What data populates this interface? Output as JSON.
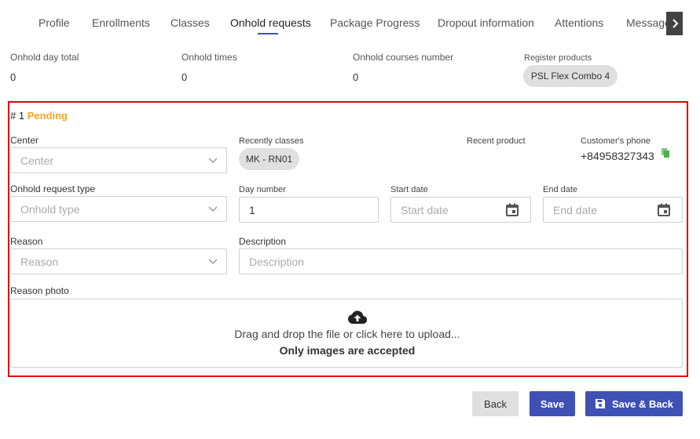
{
  "tabs": [
    {
      "label": "Profile"
    },
    {
      "label": "Enrollments"
    },
    {
      "label": "Classes"
    },
    {
      "label": "Onhold requests"
    },
    {
      "label": "Package Progress"
    },
    {
      "label": "Dropout information"
    },
    {
      "label": "Attentions"
    },
    {
      "label": "Messages"
    }
  ],
  "active_tab": "Onhold requests",
  "summary": {
    "day_total_label": "Onhold day total",
    "day_total_value": "0",
    "times_label": "Onhold times",
    "times_value": "0",
    "courses_label": "Onhold courses number",
    "courses_value": "0",
    "register_products_label": "Register products",
    "register_products_chip": "PSL Flex Combo 4"
  },
  "request": {
    "number": "# 1",
    "status": "Pending",
    "status_color": "#f5a623",
    "center_label": "Center",
    "center_placeholder": "Center",
    "recent_classes_label": "Recently classes",
    "recent_class_chip": "MK - RN01",
    "recent_product_label": "Recent product",
    "phone_label": "Customer's phone",
    "phone_value": "+84958327343",
    "type_label": "Onhold request type",
    "type_placeholder": "Onhold type",
    "day_number_label": "Day number",
    "day_number_value": "1",
    "start_date_label": "Start date",
    "start_date_placeholder": "Start date",
    "end_date_label": "End date",
    "end_date_placeholder": "End date",
    "reason_label": "Reason",
    "reason_placeholder": "Reason",
    "description_label": "Description",
    "description_placeholder": "Description",
    "photo_label": "Reason photo",
    "upload_text": "Drag and drop the file or click here to upload...",
    "upload_subtext": "Only images are accepted"
  },
  "actions": {
    "back": "Back",
    "save": "Save",
    "save_back": "Save & Back"
  },
  "colors": {
    "primary": "#3f51b5",
    "highlight_border": "#e00000",
    "copy_icon": "#4caf50"
  }
}
